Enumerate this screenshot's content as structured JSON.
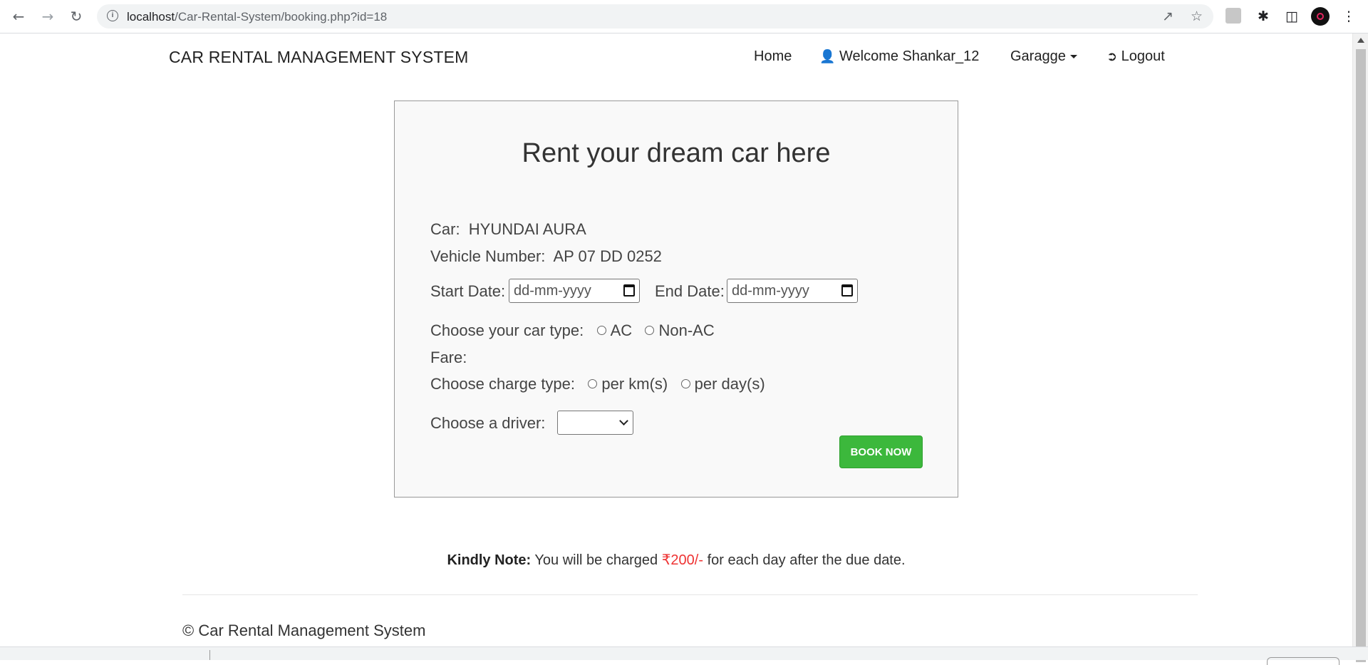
{
  "browser": {
    "url_host": "localhost",
    "url_path": "/Car-Rental-System/booking.php?id=18",
    "icons": [
      "back-arrow-icon",
      "forward-arrow-icon",
      "reload-icon",
      "info-icon",
      "share-icon",
      "star-icon",
      "extensions-icon",
      "side-panel-icon",
      "menu-icon"
    ]
  },
  "navbar": {
    "brand": "CAR RENTAL MANAGEMENT SYSTEM",
    "home": "Home",
    "welcome": "Welcome Shankar_12",
    "garage": "Garagge",
    "logout": "Logout"
  },
  "form": {
    "title": "Rent your dream car here",
    "car_label": "Car:",
    "car_value": "HYUNDAI AURA",
    "vehicle_label": "Vehicle Number:",
    "vehicle_value": "AP 07 DD 0252",
    "start_label": "Start Date:",
    "start_placeholder": "dd-mm-yyyy",
    "end_label": "End Date:",
    "end_placeholder": "dd-mm-yyyy",
    "car_type_label": "Choose your car type:",
    "car_type_options": [
      "AC",
      "Non-AC"
    ],
    "fare_label": "Fare:",
    "charge_label": "Choose charge type:",
    "charge_options": [
      "per km(s)",
      "per day(s)"
    ],
    "driver_label": "Choose a driver:",
    "driver_selected": "",
    "book_button": "BOOK NOW"
  },
  "note": {
    "bold": "Kindly Note:",
    "text1": "You will be charged",
    "amount": "₹200/-",
    "text2": "for each day after the due date."
  },
  "footer": "© Car Rental Management System",
  "colors": {
    "button_green": "#3cb83c",
    "amount_red": "#e33333",
    "card_bg": "#f9f9f9"
  }
}
